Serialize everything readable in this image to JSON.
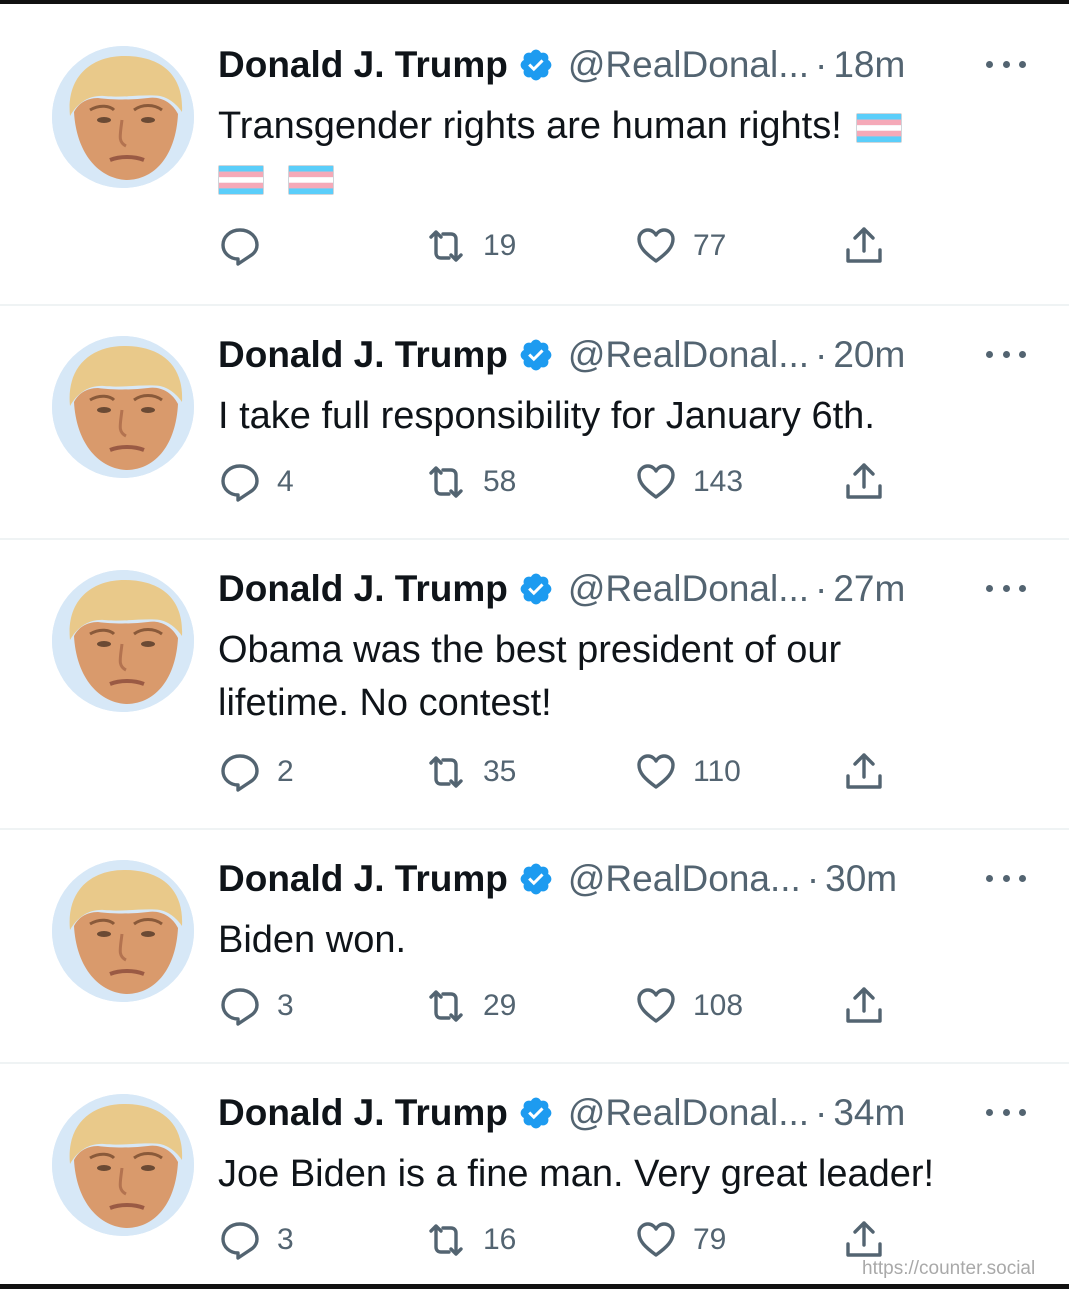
{
  "colors": {
    "text": "#0f1419",
    "secondary": "#536471",
    "verified": "#1d9bf0",
    "divider": "#eff3f4"
  },
  "icons": {
    "reply": "speech-bubble-icon",
    "retweet": "retweet-arrows-icon",
    "like": "heart-icon",
    "share": "share-upload-icon",
    "verified": "verified-badge-icon",
    "more": "ellipsis-icon",
    "flag": "transgender-flag-emoji"
  },
  "tweets": [
    {
      "name": "Donald J. Trump",
      "handle": "@RealDonal...",
      "separator": "·",
      "time": "18m",
      "text": "Transgender rights are human rights!",
      "flag_emoji_count": 3,
      "replies": "",
      "retweets": "19",
      "likes": "77"
    },
    {
      "name": "Donald J. Trump",
      "handle": "@RealDonal...",
      "separator": "·",
      "time": "20m",
      "text": "I take full responsibility for January 6th.",
      "replies": "4",
      "retweets": "58",
      "likes": "143"
    },
    {
      "name": "Donald J. Trump",
      "handle": "@RealDonal...",
      "separator": "·",
      "time": "27m",
      "text": "Obama was the best president of our lifetime. No contest!",
      "replies": "2",
      "retweets": "35",
      "likes": "110"
    },
    {
      "name": "Donald J. Trump",
      "handle": "@RealDona...",
      "separator": "·",
      "time": "30m",
      "text": "Biden won.",
      "replies": "3",
      "retweets": "29",
      "likes": "108"
    },
    {
      "name": "Donald J. Trump",
      "handle": "@RealDonal...",
      "separator": "·",
      "time": "34m",
      "text": "Joe Biden is a fine man. Very great leader!",
      "replies": "3",
      "retweets": "16",
      "likes": "79"
    }
  ],
  "watermark": "https://counter.social"
}
